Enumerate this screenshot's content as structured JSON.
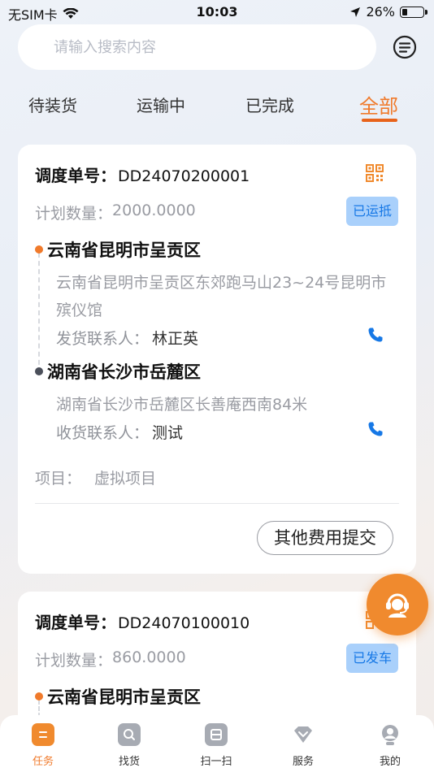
{
  "status_bar": {
    "carrier": "无SIM卡",
    "time": "10:03",
    "battery": "26%",
    "battery_level": 0.26
  },
  "search": {
    "placeholder": "请输入搜索内容",
    "value": ""
  },
  "icons": {
    "menu": "menu-list-icon",
    "qr": "qr-code-icon",
    "phone": "phone-icon",
    "service": "customer-service-icon"
  },
  "colors": {
    "accent": "#f07a2b",
    "badge_bg": "#a9d0fb",
    "badge_text": "#1678e6"
  },
  "tabs": [
    {
      "label": "待装货"
    },
    {
      "label": "运输中"
    },
    {
      "label": "已完成"
    },
    {
      "label": "全部",
      "active": true
    }
  ],
  "orders": [
    {
      "order_label": "调度单号：",
      "order_no": "DD24070200001",
      "qty_label": "计划数量：",
      "qty": "2000.0000",
      "status": "已运抵",
      "origin_city": "云南省昆明市呈贡区",
      "origin_address": "云南省昆明市呈贡区东郊跑马山23~24号昆明市殡仪馆",
      "sender_label": "发货联系人：",
      "sender_name": "林正英",
      "dest_city": "湖南省长沙市岳麓区",
      "dest_address": "湖南省长沙市岳麓区长善庵西南84米",
      "receiver_label": "收货联系人：",
      "receiver_name": "测试",
      "project_label": "项目：",
      "project": "虚拟项目",
      "action": "其他费用提交"
    },
    {
      "order_label": "调度单号：",
      "order_no": "DD24070100010",
      "qty_label": "计划数量：",
      "qty": "860.0000",
      "status": "已发车",
      "origin_city": "云南省昆明市呈贡区"
    }
  ],
  "tabbar": [
    {
      "label": "任务",
      "icon": "task-icon",
      "active": true
    },
    {
      "label": "找货",
      "icon": "find-goods-icon"
    },
    {
      "label": "扫一扫",
      "icon": "scan-icon"
    },
    {
      "label": "服务",
      "icon": "service-diamond-icon"
    },
    {
      "label": "我的",
      "icon": "profile-icon"
    }
  ]
}
